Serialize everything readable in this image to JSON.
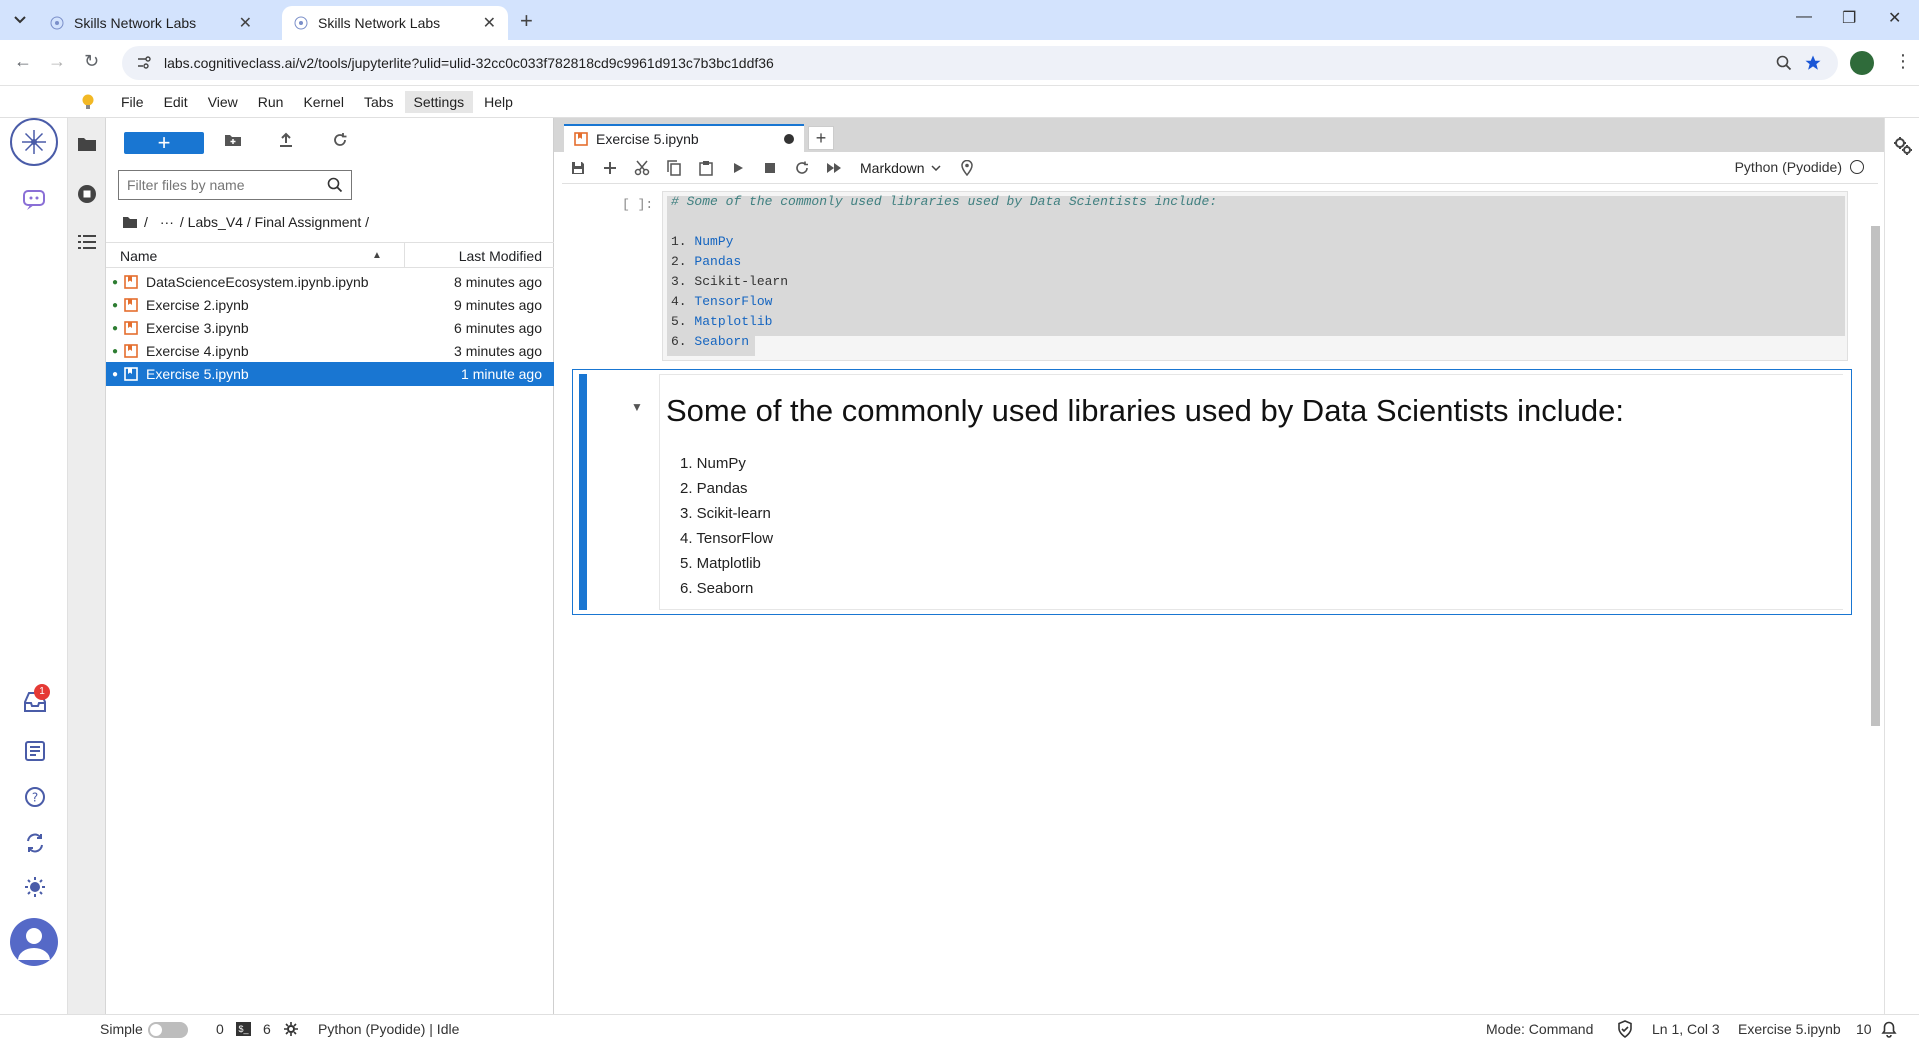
{
  "browser": {
    "tabs": [
      {
        "title": "Skills Network Labs",
        "active": false
      },
      {
        "title": "Skills Network Labs",
        "active": true
      }
    ],
    "url": "labs.cognitiveclass.ai/v2/tools/jupyterlite?ulid=ulid-32cc0c033f782818cd9c9961d913c7b3bc1ddf36"
  },
  "menu": [
    "File",
    "Edit",
    "View",
    "Run",
    "Kernel",
    "Tabs",
    "Settings",
    "Help"
  ],
  "sidebar": {
    "inbox_badge": "1"
  },
  "filebrowser": {
    "new_label": "+",
    "filter_placeholder": "Filter files by name",
    "breadcrumb": [
      "/",
      "···",
      "/ Labs_V4 / Final Assignment /"
    ],
    "header_name": "Name",
    "header_modified": "Last Modified",
    "files": [
      {
        "name": "DataScienceEcosystem.ipynb.ipynb",
        "modified": "8 minutes ago",
        "selected": false
      },
      {
        "name": "Exercise 2.ipynb",
        "modified": "9 minutes ago",
        "selected": false
      },
      {
        "name": "Exercise 3.ipynb",
        "modified": "6 minutes ago",
        "selected": false
      },
      {
        "name": "Exercise 4.ipynb",
        "modified": "3 minutes ago",
        "selected": false
      },
      {
        "name": "Exercise 5.ipynb",
        "modified": "1 minute ago",
        "selected": true
      }
    ]
  },
  "notebook": {
    "tab_title": "Exercise 5.ipynb",
    "cell_type": "Markdown",
    "kernel": "Python (Pyodide)",
    "cell1_prompt": "[ ]:",
    "cell1_lines": [
      {
        "n": "",
        "text": "# Some of the commonly used libraries used by Data Scientists include:"
      },
      {
        "n": "",
        "text": ""
      },
      {
        "n": "1.",
        "text": "NumPy"
      },
      {
        "n": "2.",
        "text": "Pandas"
      },
      {
        "n": "3.",
        "text": "Scikit-learn"
      },
      {
        "n": "4.",
        "text": "TensorFlow"
      },
      {
        "n": "5.",
        "text": "Matplotlib"
      },
      {
        "n": "6.",
        "text": "Seaborn"
      }
    ],
    "rendered_heading": "Some of the commonly used libraries used by Data Scientists include:",
    "rendered_list": [
      "1. NumPy",
      "2. Pandas",
      "3. Scikit-learn",
      "4. TensorFlow",
      "5. Matplotlib",
      "6. Seaborn"
    ]
  },
  "statusbar": {
    "mode_label": "Simple",
    "count_a": "0",
    "count_b": "6",
    "kernel_status": "Python (Pyodide) | Idle",
    "mode": "Mode: Command",
    "position": "Ln 1, Col 3",
    "filename": "Exercise 5.ipynb",
    "notifications": "10"
  }
}
